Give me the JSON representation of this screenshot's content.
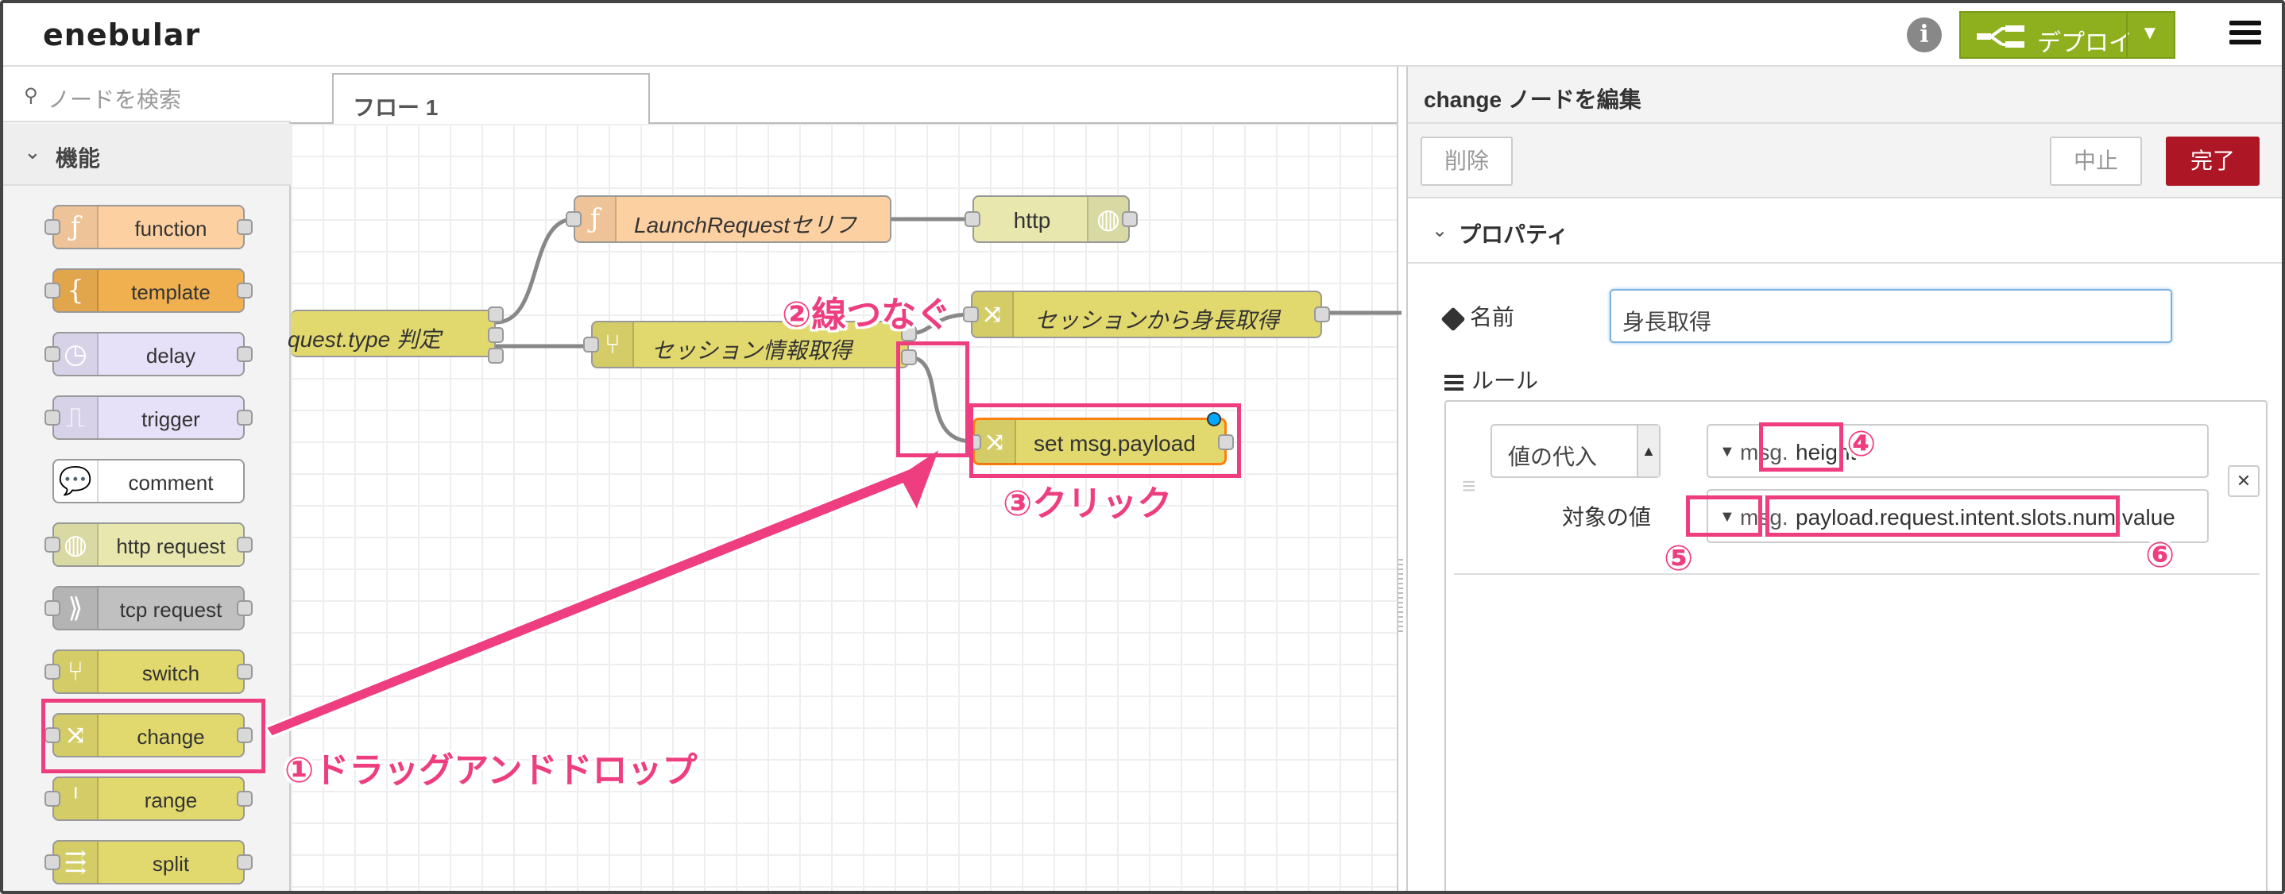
{
  "header": {
    "logo": "enebular",
    "deploy_label": "デプロイ"
  },
  "palette": {
    "search_placeholder": "ノードを検索",
    "category": "機能",
    "nodes": [
      {
        "label": "function",
        "color": "#fdd0a2",
        "icon": "function-icon"
      },
      {
        "label": "template",
        "color": "#f0b050",
        "icon": "template-icon"
      },
      {
        "label": "delay",
        "color": "#e6e0f8",
        "icon": "delay-icon"
      },
      {
        "label": "trigger",
        "color": "#e6e0f8",
        "icon": "trigger-icon"
      },
      {
        "label": "comment",
        "color": "#ffffff",
        "icon": "comment-icon"
      },
      {
        "label": "http request",
        "color": "#e7e7ae",
        "icon": "globe-icon"
      },
      {
        "label": "tcp request",
        "color": "#c0c0c0",
        "icon": "tcp-icon"
      },
      {
        "label": "switch",
        "color": "#e2d96e",
        "icon": "switch-icon"
      },
      {
        "label": "change",
        "color": "#e2d96e",
        "icon": "change-icon"
      },
      {
        "label": "range",
        "color": "#e2d96e",
        "icon": "range-icon"
      },
      {
        "label": "split",
        "color": "#e2d96e",
        "icon": "split-icon"
      }
    ]
  },
  "workspace": {
    "tab_label": "フロー 1",
    "nodes": [
      {
        "label": "LaunchRequestセリフ",
        "color": "#fdd0a2",
        "icon": "function-icon"
      },
      {
        "label": "http",
        "color": "#e7e7ae",
        "icon": "globe-icon"
      },
      {
        "label": "quest.type 判定",
        "color": "#e2d96e",
        "icon": "switch-icon"
      },
      {
        "label": "セッション情報取得",
        "color": "#e2d96e",
        "icon": "switch-icon"
      },
      {
        "label": "セッションから身長取得",
        "color": "#e2d96e",
        "icon": "change-icon"
      },
      {
        "label": "set msg.payload",
        "color": "#e2d96e",
        "icon": "change-icon"
      }
    ]
  },
  "editor": {
    "title": "change ノードを編集",
    "delete_label": "削除",
    "cancel_label": "中止",
    "done_label": "完了",
    "section_label": "プロパティ",
    "name_label": "名前",
    "name_value": "身長取得",
    "rules_label": "ルール",
    "rule": {
      "action": "値の代入",
      "target_prefix": "msg.",
      "target_value": "height",
      "value_label": "対象の値",
      "value_prefix": "msg.",
      "value_value": "payload.request.intent.slots.num.value"
    }
  },
  "annotations": {
    "step1": "①ドラッグアンドドロップ",
    "step2": "②線つなぐ",
    "step3": "③クリック",
    "step4": "④",
    "step5": "⑤",
    "step6": "⑥",
    "color": "#ee3e80"
  }
}
